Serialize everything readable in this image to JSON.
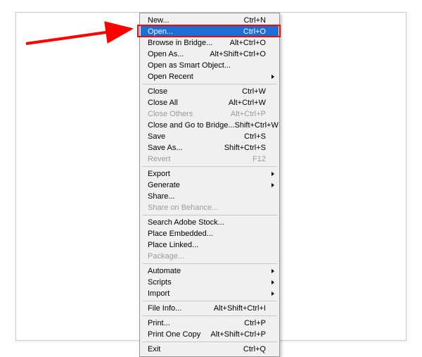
{
  "menu": {
    "groups": [
      [
        {
          "label": "New...",
          "shortcut": "Ctrl+N",
          "disabled": false,
          "submenu": false,
          "selected": false
        },
        {
          "label": "Open...",
          "shortcut": "Ctrl+O",
          "disabled": false,
          "submenu": false,
          "selected": true
        },
        {
          "label": "Browse in Bridge...",
          "shortcut": "Alt+Ctrl+O",
          "disabled": false,
          "submenu": false,
          "selected": false
        },
        {
          "label": "Open As...",
          "shortcut": "Alt+Shift+Ctrl+O",
          "disabled": false,
          "submenu": false,
          "selected": false
        },
        {
          "label": "Open as Smart Object...",
          "shortcut": "",
          "disabled": false,
          "submenu": false,
          "selected": false
        },
        {
          "label": "Open Recent",
          "shortcut": "",
          "disabled": false,
          "submenu": true,
          "selected": false
        }
      ],
      [
        {
          "label": "Close",
          "shortcut": "Ctrl+W",
          "disabled": false,
          "submenu": false,
          "selected": false
        },
        {
          "label": "Close All",
          "shortcut": "Alt+Ctrl+W",
          "disabled": false,
          "submenu": false,
          "selected": false
        },
        {
          "label": "Close Others",
          "shortcut": "Alt+Ctrl+P",
          "disabled": true,
          "submenu": false,
          "selected": false
        },
        {
          "label": "Close and Go to Bridge...",
          "shortcut": "Shift+Ctrl+W",
          "disabled": false,
          "submenu": false,
          "selected": false
        },
        {
          "label": "Save",
          "shortcut": "Ctrl+S",
          "disabled": false,
          "submenu": false,
          "selected": false
        },
        {
          "label": "Save As...",
          "shortcut": "Shift+Ctrl+S",
          "disabled": false,
          "submenu": false,
          "selected": false
        },
        {
          "label": "Revert",
          "shortcut": "F12",
          "disabled": true,
          "submenu": false,
          "selected": false
        }
      ],
      [
        {
          "label": "Export",
          "shortcut": "",
          "disabled": false,
          "submenu": true,
          "selected": false
        },
        {
          "label": "Generate",
          "shortcut": "",
          "disabled": false,
          "submenu": true,
          "selected": false
        },
        {
          "label": "Share...",
          "shortcut": "",
          "disabled": false,
          "submenu": false,
          "selected": false
        },
        {
          "label": "Share on Behance...",
          "shortcut": "",
          "disabled": true,
          "submenu": false,
          "selected": false
        }
      ],
      [
        {
          "label": "Search Adobe Stock...",
          "shortcut": "",
          "disabled": false,
          "submenu": false,
          "selected": false
        },
        {
          "label": "Place Embedded...",
          "shortcut": "",
          "disabled": false,
          "submenu": false,
          "selected": false
        },
        {
          "label": "Place Linked...",
          "shortcut": "",
          "disabled": false,
          "submenu": false,
          "selected": false
        },
        {
          "label": "Package...",
          "shortcut": "",
          "disabled": true,
          "submenu": false,
          "selected": false
        }
      ],
      [
        {
          "label": "Automate",
          "shortcut": "",
          "disabled": false,
          "submenu": true,
          "selected": false
        },
        {
          "label": "Scripts",
          "shortcut": "",
          "disabled": false,
          "submenu": true,
          "selected": false
        },
        {
          "label": "Import",
          "shortcut": "",
          "disabled": false,
          "submenu": true,
          "selected": false
        }
      ],
      [
        {
          "label": "File Info...",
          "shortcut": "Alt+Shift+Ctrl+I",
          "disabled": false,
          "submenu": false,
          "selected": false
        }
      ],
      [
        {
          "label": "Print...",
          "shortcut": "Ctrl+P",
          "disabled": false,
          "submenu": false,
          "selected": false
        },
        {
          "label": "Print One Copy",
          "shortcut": "Alt+Shift+Ctrl+P",
          "disabled": false,
          "submenu": false,
          "selected": false
        }
      ],
      [
        {
          "label": "Exit",
          "shortcut": "Ctrl+Q",
          "disabled": false,
          "submenu": false,
          "selected": false
        }
      ]
    ]
  },
  "annotation": {
    "highlight_color": "#ff0000",
    "arrow_color": "#ff0000"
  }
}
